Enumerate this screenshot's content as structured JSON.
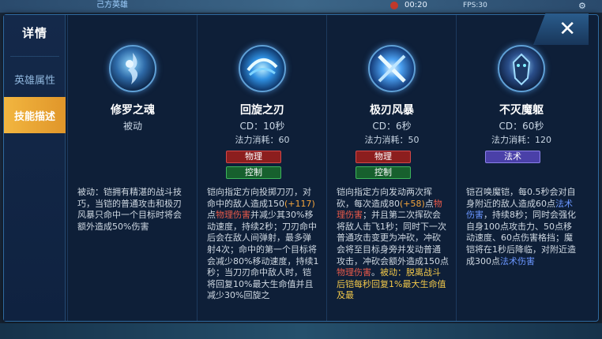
{
  "hud": {
    "team_label": "己方英雄",
    "time": "00:20",
    "fps": "FPS:30"
  },
  "sidebar": {
    "title": "详情",
    "items": [
      {
        "label": "英雄属性",
        "active": false
      },
      {
        "label": "技能描述",
        "active": true
      }
    ]
  },
  "close_label": "✕",
  "skills": [
    {
      "name": "修罗之魂",
      "type": "被动",
      "cd": "",
      "cost": "",
      "tags": [],
      "desc_parts": [
        {
          "text": "被动：铠拥有精湛的战斗技巧，当铠的普通攻击和极刃风暴只命中一个目标时将会额外造成50%伤害",
          "style": ""
        }
      ]
    },
    {
      "name": "回旋之刃",
      "type": "",
      "cd": "CD：10秒",
      "cost": "法力消耗：60",
      "tags": [
        {
          "label": "物理",
          "kind": "phys"
        },
        {
          "label": "控制",
          "kind": "ctrl"
        }
      ],
      "desc_parts": [
        {
          "text": "铠向指定方向投掷刀刃，对命中的敌人造成150",
          "style": ""
        },
        {
          "text": "(+117)",
          "style": "o"
        },
        {
          "text": "点",
          "style": ""
        },
        {
          "text": "物理伤害",
          "style": "r"
        },
        {
          "text": "并减少其30%移动速度，持续2秒；刀刃命中后会在敌人间弹射，最多弹射4次；命中的第一个目标将会减少80%移动速度，持续1秒；当刀刃命中敌人时，铠将回复10%最大生命值并且减少30%回旋之",
          "style": ""
        }
      ]
    },
    {
      "name": "极刃风暴",
      "type": "",
      "cd": "CD：6秒",
      "cost": "法力消耗：50",
      "tags": [
        {
          "label": "物理",
          "kind": "phys"
        },
        {
          "label": "控制",
          "kind": "ctrl"
        }
      ],
      "desc_parts": [
        {
          "text": "铠向指定方向发动两次挥砍，每次造成80",
          "style": ""
        },
        {
          "text": "(+58)",
          "style": "o"
        },
        {
          "text": "点",
          "style": ""
        },
        {
          "text": "物理伤害",
          "style": "r"
        },
        {
          "text": "；并且第二次挥砍会将敌人击飞1秒；同时下一次普通攻击变更为冲砍，冲砍会将至目标身旁并发动普通攻击，冲砍会额外造成150点",
          "style": ""
        },
        {
          "text": "物理伤害",
          "style": "r"
        },
        {
          "text": "。",
          "style": ""
        },
        {
          "text": "被动：脱离战斗后铠每秒回复1%最大生命值及最",
          "style": "y"
        }
      ]
    },
    {
      "name": "不灭魔躯",
      "type": "",
      "cd": "CD：60秒",
      "cost": "法力消耗：120",
      "tags": [
        {
          "label": "法术",
          "kind": "magic"
        }
      ],
      "desc_parts": [
        {
          "text": "铠召唤魔铠，每0.5秒会对自身附近的敌人造成60点",
          "style": ""
        },
        {
          "text": "法术伤害",
          "style": "b"
        },
        {
          "text": "，持续8秒；同时会强化自身100点攻击力、50点移动速度、60点伤害格挡；魔铠将在1秒后降临，对附近造成300点",
          "style": ""
        },
        {
          "text": "法术伤害",
          "style": "b"
        }
      ]
    }
  ],
  "icons": {
    "skill_0": "shura-soul-icon",
    "skill_1": "spinning-blade-icon",
    "skill_2": "blade-storm-icon",
    "skill_3": "demon-armor-icon"
  }
}
